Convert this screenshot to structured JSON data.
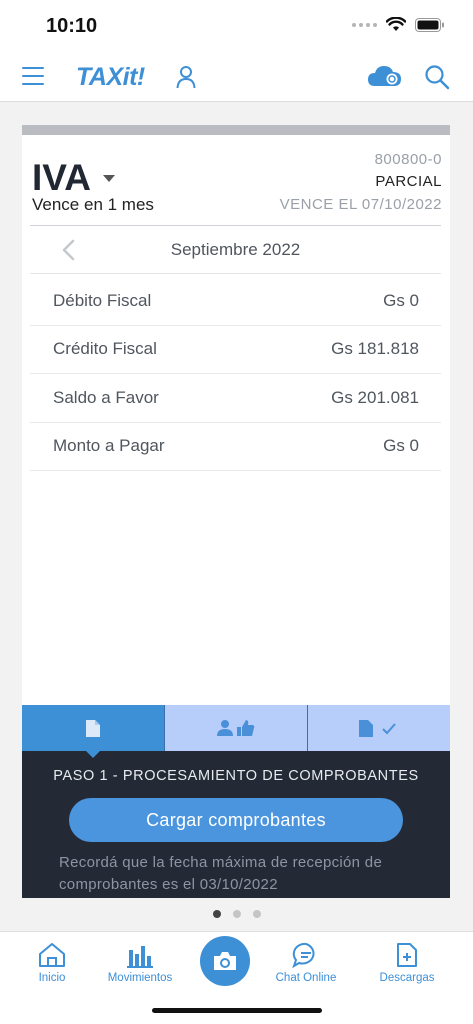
{
  "status": {
    "time": "10:10"
  },
  "header": {
    "logo": "TAXit!"
  },
  "card": {
    "tax_name": "IVA",
    "due_in": "Vence en 1 mes",
    "number": "800800-0",
    "type": "PARCIAL",
    "expiry": "VENCE EL 07/10/2022",
    "period": "Septiembre 2022",
    "rows": [
      {
        "label": "Débito Fiscal",
        "value": "Gs 0"
      },
      {
        "label": "Crédito Fiscal",
        "value": "Gs 181.818"
      },
      {
        "label": "Saldo a Favor",
        "value": "Gs 201.081"
      },
      {
        "label": "Monto a Pagar",
        "value": "Gs 0"
      }
    ]
  },
  "steps": {
    "current_title": "PASO 1 - PROCESAMIENTO DE COMPROBANTES",
    "button_label": "Cargar comprobantes",
    "reminder": "Recordá que la fecha máxima de recepción de comprobantes es el 03/10/2022"
  },
  "tabbar": {
    "inicio": "Inicio",
    "movimientos": "Movimientos",
    "chat": "Chat Online",
    "descargas": "Descargas"
  },
  "colors": {
    "accent": "#3d8fd6",
    "panel": "#232a35",
    "tab_inactive": "#b8cefa"
  }
}
